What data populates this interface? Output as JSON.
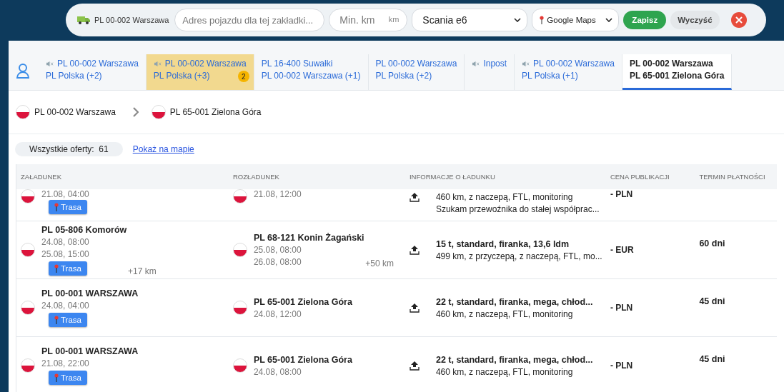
{
  "toolbar": {
    "vehicle": "PL 00-002 Warszawa",
    "address": {
      "placeholder": "Adres pojazdu dla tej zakładki..."
    },
    "min_km": {
      "placeholder": "Min. km",
      "unit": "km"
    },
    "truck_select": "Scania e6",
    "map_select": "Google Maps",
    "save": "Zapisz",
    "clear": "Wyczyść"
  },
  "tabs": [
    {
      "line1": "PL 00-002 Warszawa",
      "line2": "PL Polska (+2)",
      "muted": true,
      "highlighted": false,
      "selected": false
    },
    {
      "line1": "PL 00-002 Warszawa",
      "line2": "PL Polska (+3)",
      "muted": true,
      "highlighted": true,
      "badge": "2",
      "selected": false
    },
    {
      "line1": "PL 16-400 Suwałki",
      "line2": "PL 00-002 Warszawa (+1)",
      "muted": false,
      "highlighted": false,
      "selected": false
    },
    {
      "line1": "PL 00-002 Warszawa",
      "line2": "PL Polska (+2)",
      "muted": false,
      "highlighted": false,
      "selected": false
    },
    {
      "line1": "Inpost",
      "muted": true,
      "highlighted": false,
      "selected": false
    },
    {
      "line1": "PL 00-002 Warszawa",
      "line2": "PL Polska (+1)",
      "muted": true,
      "highlighted": false,
      "selected": false
    },
    {
      "line1": "PL 00-002 Warszawa",
      "line2": "PL 65-001 Zielona Góra",
      "muted": false,
      "highlighted": false,
      "selected": true
    }
  ],
  "route": {
    "from": "PL 00-002 Warszawa",
    "to": "PL 65-001 Zielona Góra"
  },
  "offers": {
    "count_label": "Wszystkie oferty:",
    "count": "61",
    "map_link": "Pokaż na mapie"
  },
  "table": {
    "columns": [
      "ZAŁADUNEK",
      "ROZŁADUNEK",
      "INFORMACJE O ŁADUNKU",
      "CENA PUBLIKACJI",
      "TERMIN PŁATNOŚCI"
    ],
    "rows": [
      {
        "kind": "partial",
        "loading": {
          "dates": [
            "21.08, 04:00"
          ],
          "route_button": "Trasa"
        },
        "unloading": {
          "dates": [
            "21.08, 12:00"
          ]
        },
        "info": {
          "details": [
            "460 km, z naczepą, FTL, monitoring",
            "Szukam przewoźnika do stałej współprac..."
          ]
        },
        "price": "- PLN"
      },
      {
        "kind": "full",
        "loading": {
          "place": "PL 05-806 Komorów",
          "dates": [
            "24.08, 08:00",
            "25.08, 15:00"
          ],
          "route_button": "Trasa",
          "extra_km": "+17 km"
        },
        "unloading": {
          "place": "PL 68-121 Konin Żagański",
          "dates": [
            "25.08, 08:00",
            "26.08, 08:00"
          ],
          "extra_km": "+50 km"
        },
        "info": {
          "title": "15 t, standard, firanka, 13,6 ldm",
          "details": [
            "499 km, z przyczepą, z naczepą, FTL, mo..."
          ]
        },
        "price": "- EUR",
        "term": "60 dni"
      },
      {
        "kind": "full",
        "loading": {
          "place": "PL 00-001 WARSZAWA",
          "dates": [
            "24.08, 04:00"
          ],
          "route_button": "Trasa"
        },
        "unloading": {
          "place": "PL 65-001 Zielona Góra",
          "dates": [
            "24.08, 12:00"
          ]
        },
        "info": {
          "title": "22 t, standard, firanka, mega, chłod...",
          "details": [
            "460 km, z naczepą, FTL, monitoring"
          ]
        },
        "price": "- PLN",
        "term": "45 dni"
      },
      {
        "kind": "full",
        "loading": {
          "place": "PL 00-001 WARSZAWA",
          "dates": [
            "21.08, 22:00"
          ],
          "route_button": "Trasa"
        },
        "unloading": {
          "place": "PL 65-001 Zielona Góra",
          "dates": [
            "24.08, 08:00"
          ]
        },
        "info": {
          "title": "22 t, standard, firanka, mega, chłod...",
          "details": [
            "460 km, z naczepą, FTL, monitoring"
          ]
        },
        "price": "- PLN",
        "term": "45 dni"
      }
    ]
  }
}
